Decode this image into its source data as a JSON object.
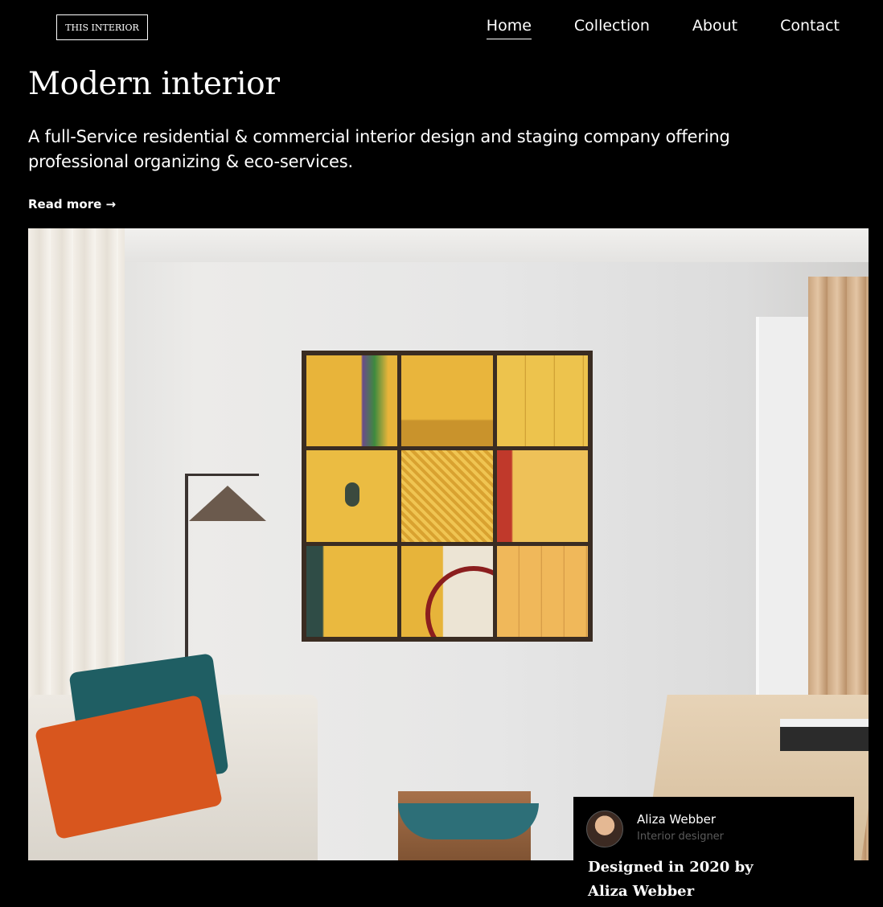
{
  "header": {
    "logo": "THIS INTERIOR",
    "nav": [
      {
        "label": "Home",
        "active": true
      },
      {
        "label": "Collection",
        "active": false
      },
      {
        "label": "About",
        "active": false
      },
      {
        "label": "Contact",
        "active": false
      }
    ]
  },
  "hero": {
    "title": "Modern interior",
    "subtitle": "A full-Service residential & commercial interior design and staging company offering professional organizing & eco-services.",
    "read_more": "Read more →"
  },
  "designer_card": {
    "name": "Aliza Webber",
    "role": "Interior designer",
    "designed_text": "Designed in 2020 by Aliza Webber"
  },
  "colors": {
    "background": "#000000",
    "text": "#ffffff",
    "muted": "#5b5b5b"
  }
}
